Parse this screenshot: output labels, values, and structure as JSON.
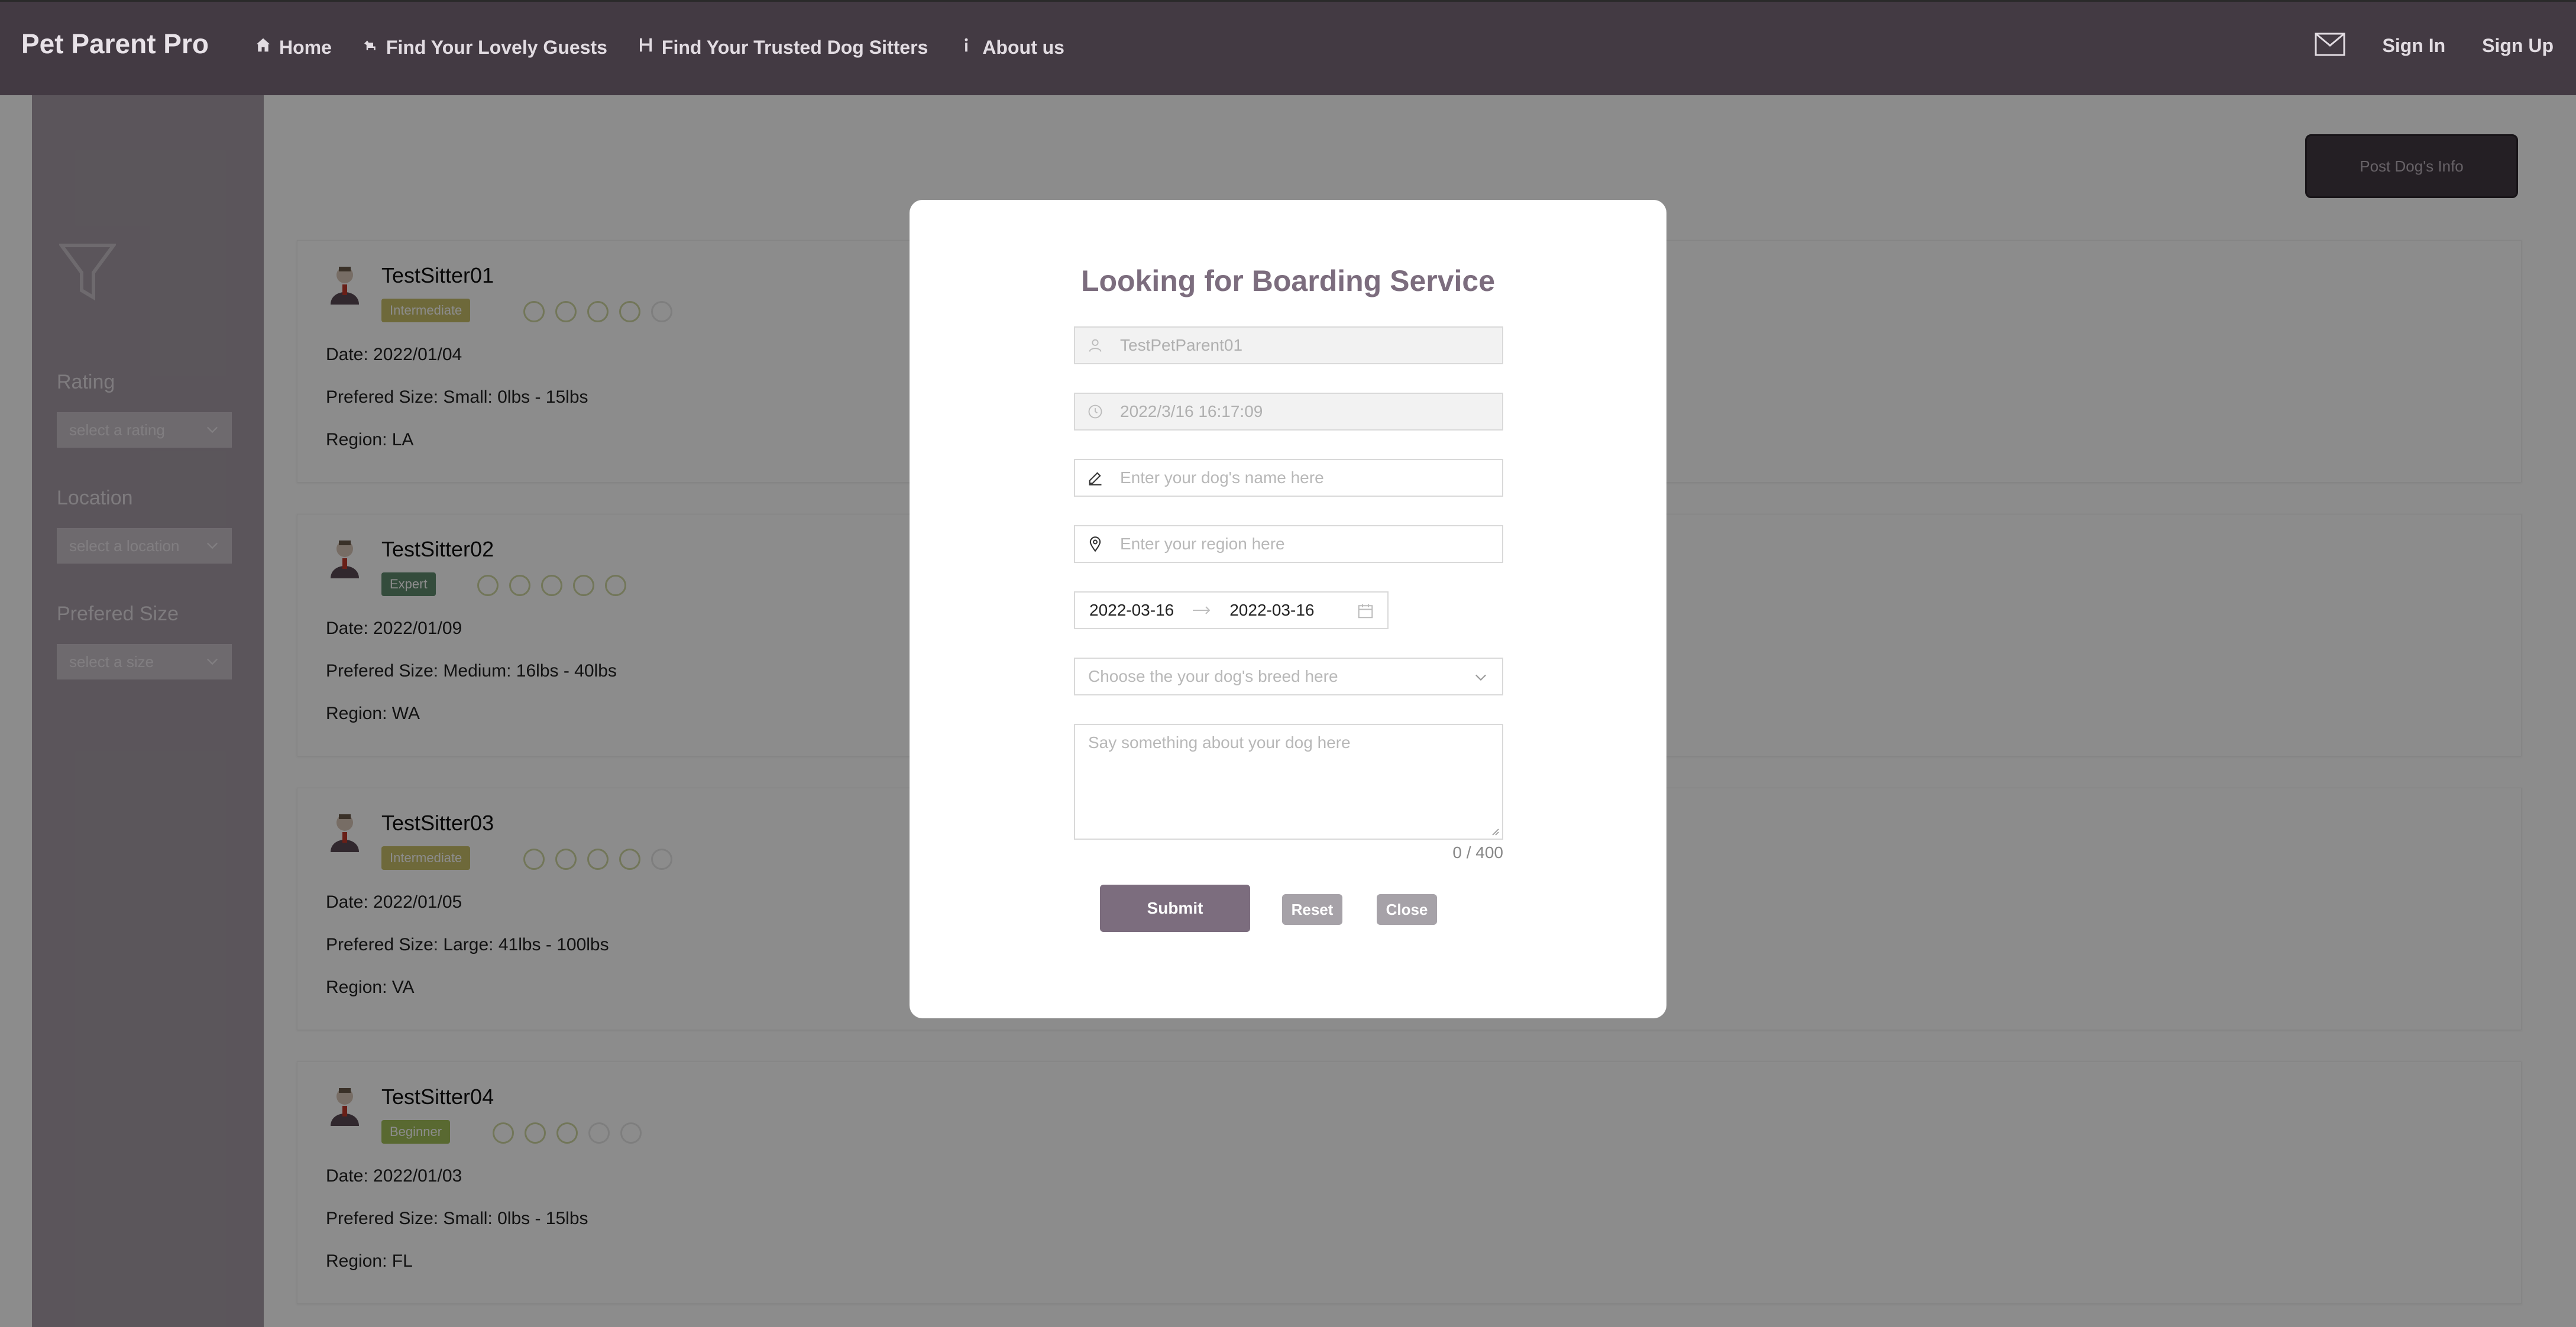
{
  "header": {
    "brand": "Pet Parent Pro",
    "nav": [
      {
        "label": "Home",
        "icon": "home-icon"
      },
      {
        "label": "Find Your Lovely Guests",
        "icon": "dog-icon"
      },
      {
        "label": "Find Your Trusted Dog Sitters",
        "icon": "bone-icon"
      },
      {
        "label": "About us",
        "icon": "info-icon"
      }
    ],
    "sign_in": "Sign In",
    "sign_up": "Sign Up"
  },
  "sidebar": {
    "rating_label": "Rating",
    "rating_placeholder": "select a rating",
    "location_label": "Location",
    "location_placeholder": "select a location",
    "size_label": "Prefered Size",
    "size_placeholder": "select a size"
  },
  "post_button": "Post Dog's Info",
  "sitters": [
    {
      "name": "TestSitter01",
      "level": "Intermediate",
      "level_color": "#c9c06a",
      "rating": 4,
      "date": "Date: 2022/01/04",
      "size": "Prefered Size: Small: 0lbs - 15lbs",
      "region": "Region: LA"
    },
    {
      "name": "TestSitter02",
      "level": "Expert",
      "level_color": "#5f8a6e",
      "rating": 5,
      "date": "Date: 2022/01/09",
      "size": "Prefered Size: Medium: 16lbs - 40lbs",
      "region": "Region: WA"
    },
    {
      "name": "TestSitter03",
      "level": "Intermediate",
      "level_color": "#c9c06a",
      "rating": 4,
      "date": "Date: 2022/01/05",
      "size": "Prefered Size: Large: 41lbs - 100lbs",
      "region": "Region: VA"
    },
    {
      "name": "TestSitter04",
      "level": "Beginner",
      "level_color": "#a2c05a",
      "rating": 3,
      "date": "Date: 2022/01/03",
      "size": "Prefered Size: Small: 0lbs - 15lbs",
      "region": "Region: FL"
    }
  ],
  "modal": {
    "title": "Looking for Boarding Service",
    "user": "TestPetParent01",
    "datetime": "2022/3/16 16:17:09",
    "dog_name_placeholder": "Enter your dog's name here",
    "region_placeholder": "Enter your region here",
    "start_date": "2022-03-16",
    "end_date": "2022-03-16",
    "breed_placeholder": "Choose the your dog's breed here",
    "description_placeholder": "Say something about your dog here",
    "counter": "0 / 400",
    "submit": "Submit",
    "reset": "Reset",
    "close": "Close"
  },
  "colors": {
    "header_bg": "#433a43",
    "accent": "#7c6d7e",
    "button_gray": "#a6a2a8"
  }
}
